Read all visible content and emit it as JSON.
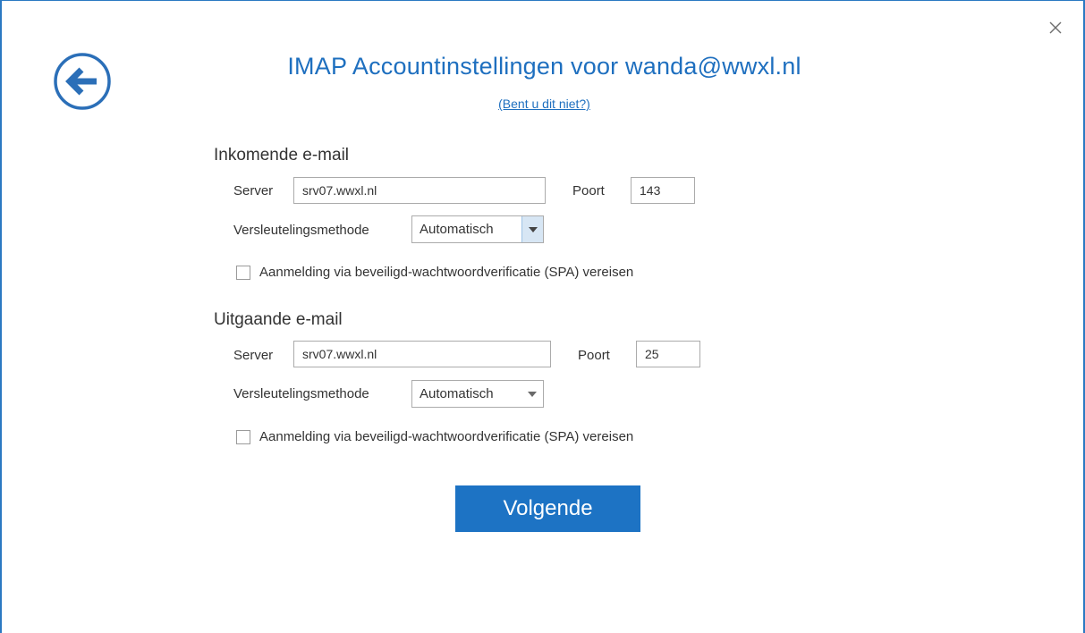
{
  "dialog": {
    "title": "IMAP Accountinstellingen voor wanda@wwxl.nl",
    "not_you_link": "(Bent u dit niet?)",
    "back_icon": "back-arrow-circle-icon",
    "close_icon": "close-x-icon"
  },
  "incoming": {
    "section_title": "Inkomende e-mail",
    "server_label": "Server",
    "server_value": "srv07.wwxl.nl",
    "port_label": "Poort",
    "port_value": "143",
    "encryption_label": "Versleutelingsmethode",
    "encryption_value": "Automatisch",
    "spa_label": "Aanmelding via beveiligd-wachtwoordverificatie (SPA) vereisen",
    "spa_checked": false
  },
  "outgoing": {
    "section_title": "Uitgaande e-mail",
    "server_label": "Server",
    "server_value": "srv07.wwxl.nl",
    "port_label": "Poort",
    "port_value": "25",
    "encryption_label": "Versleutelingsmethode",
    "encryption_value": "Automatisch",
    "spa_label": "Aanmelding via beveiligd-wachtwoordverificatie (SPA) vereisen",
    "spa_checked": false
  },
  "actions": {
    "next_label": "Volgende"
  },
  "colors": {
    "accent": "#1d73c4",
    "title": "#1e6fbf",
    "border": "#2b79c2"
  }
}
